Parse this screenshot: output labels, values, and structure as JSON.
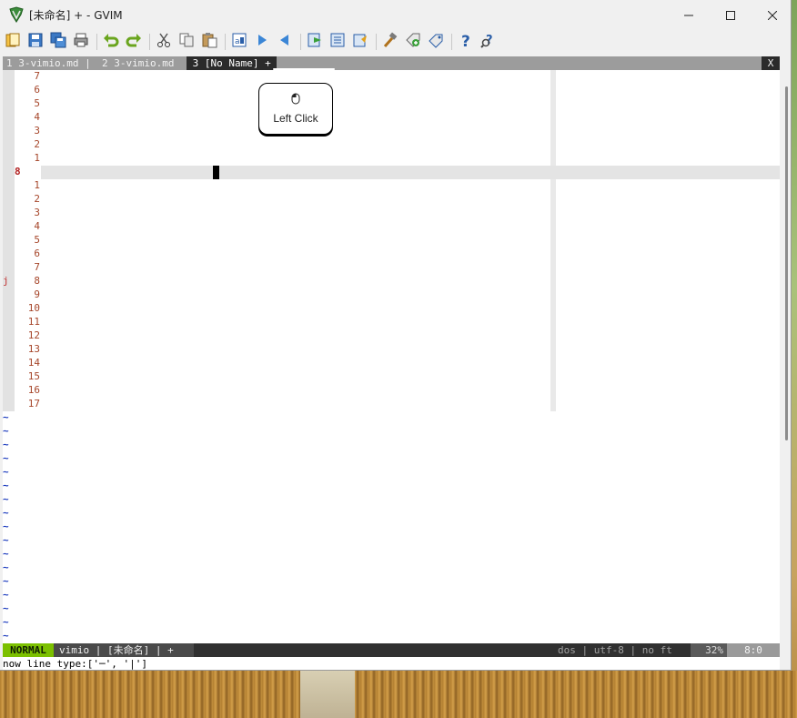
{
  "window": {
    "title": "[未命名] + - GVIM",
    "controls": {
      "minimize_icon": "minimize-icon",
      "maximize_icon": "maximize-icon",
      "close_icon": "close-icon"
    }
  },
  "toolbar": {
    "icons": [
      "open-icon",
      "save-icon",
      "save-all-icon",
      "print-icon",
      "undo-icon",
      "redo-icon",
      "cut-icon",
      "copy-icon",
      "paste-icon",
      "find-replace-icon",
      "find-next-icon",
      "find-prev-icon",
      "load-session-icon",
      "save-session-icon",
      "run-script-icon",
      "make-icon",
      "run-ctags-icon",
      "jump-tag-icon",
      "help-icon",
      "find-help-icon"
    ]
  },
  "tabline": {
    "tab1": "1 3-vimio.md | ",
    "tab2": "2 3-vimio.md ",
    "tab3": " 3 [No Name] + ",
    "close": "X"
  },
  "editor": {
    "relative_lines_above": [
      "7",
      "6",
      "5",
      "4",
      "3",
      "2",
      "1"
    ],
    "current_line": "8",
    "relative_lines_below": [
      "1",
      "2",
      "3",
      "4",
      "5",
      "6",
      "7",
      "8",
      "9",
      "10",
      "11",
      "12",
      "13",
      "14",
      "15",
      "16",
      "17"
    ],
    "mark": "j",
    "tilde": "~"
  },
  "statusline": {
    "mode": "NORMAL",
    "file": "vimio | [未命名] | +",
    "encoding": "dos | utf-8 | no ft",
    "percent": "32%",
    "position": "8:0"
  },
  "cmdline": "now line type:['─', '|']",
  "overlay": {
    "icon": "mouse-icon",
    "label": "Left Click"
  },
  "colors": {
    "mode_bg": "#7bc000",
    "line_number": "#a6462a",
    "tilde": "#1c3bbd"
  }
}
